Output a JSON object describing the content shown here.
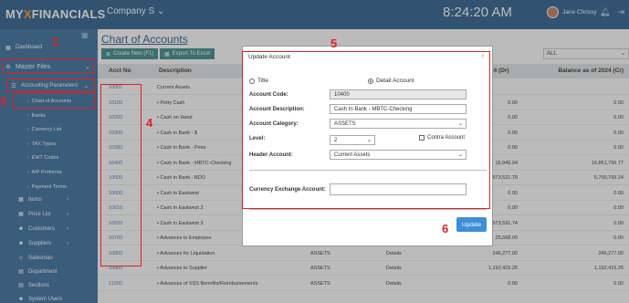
{
  "topbar": {
    "logo_prefix": "MY",
    "logo_x": "X",
    "logo_suffix": "FINANCIALS",
    "company": "Company S",
    "clock": "8:24:20 AM",
    "user_name": "Jane Chrissy"
  },
  "sidebar": {
    "items": [
      {
        "label": "Dashboard",
        "icon": "dashboard-icon"
      },
      {
        "label": "Master Files",
        "icon": "gear-icon"
      },
      {
        "label": "Accounting Parameters",
        "icon": "list-icon"
      },
      {
        "label": "Chart of Accounts"
      },
      {
        "label": "Banks"
      },
      {
        "label": "Currency List"
      },
      {
        "label": "TAX Types"
      },
      {
        "label": "EWT Codes"
      },
      {
        "label": "A/P Proforma"
      },
      {
        "label": "Payment Terms"
      },
      {
        "label": "Items",
        "icon": "grid-icon"
      },
      {
        "label": "Price List",
        "icon": "grid-icon"
      },
      {
        "label": "Customers",
        "icon": "users-icon"
      },
      {
        "label": "Suppliers",
        "icon": "users-icon"
      },
      {
        "label": "Salesman",
        "icon": "person-icon"
      },
      {
        "label": "Department",
        "icon": "building-icon"
      },
      {
        "label": "Sections",
        "icon": "building-icon"
      },
      {
        "label": "System Users",
        "icon": "users-icon"
      }
    ]
  },
  "main": {
    "page_title": "Chart of Accounts",
    "create_btn": "Create New (F1)",
    "export_btn": "Export To Excel",
    "filter_value": "ALL",
    "columns": [
      "Acct No",
      "Description",
      "(Dr)",
      "Balance as of 2024 (Cr)"
    ],
    "col_year_label": "24 (Dr)",
    "rows": [
      {
        "no": "10001",
        "desc": "Current Assets",
        "cat": "",
        "det": "",
        "bal1": "",
        "bal2": ""
      },
      {
        "no": "10100",
        "desc": "• Petty Cash",
        "cat": "",
        "det": "",
        "bal1": "0.00",
        "bal2": "0.00"
      },
      {
        "no": "10200",
        "desc": "• Cash on Hand",
        "cat": "",
        "det": "",
        "bal1": "0.00",
        "bal2": "0.00"
      },
      {
        "no": "10300",
        "desc": "• Cash in Bank - $",
        "cat": "",
        "det": "",
        "bal1": "0.00",
        "bal2": "0.00"
      },
      {
        "no": "10390",
        "desc": "• Cash in Bank - Peso",
        "cat": "",
        "det": "",
        "bal1": "0.00",
        "bal2": "0.00"
      },
      {
        "no": "10400",
        "desc": "• Cash in Bank - MBTC-Checking",
        "cat": "",
        "det": "",
        "bal1": "16,949.94",
        "bal2": "16,851,756.77"
      },
      {
        "no": "10500",
        "desc": "• Cash in Bank - BDO",
        "cat": "",
        "det": "",
        "bal1": "673,521.79",
        "bal2": "5,700,769.24"
      },
      {
        "no": "10600",
        "desc": "• Cash in Eastwest",
        "cat": "",
        "det": "",
        "bal1": "0.00",
        "bal2": "0.00"
      },
      {
        "no": "10610",
        "desc": "• Cash in Eastwest 2",
        "cat": "",
        "det": "",
        "bal1": "0.00",
        "bal2": "0.00"
      },
      {
        "no": "10620",
        "desc": "• Cash in Eastwest 3",
        "cat": "",
        "det": "",
        "bal1": "573,591.74",
        "bal2": "0.00"
      },
      {
        "no": "10700",
        "desc": "• Advances to Employee",
        "cat": "ASSETS",
        "det": "Details",
        "bal1": "25,668.00",
        "bal2": "0.00"
      },
      {
        "no": "10800",
        "desc": "• Advances for Liquidation",
        "cat": "ASSETS",
        "det": "Details",
        "bal1": "246,277.00",
        "bal2": "246,277.00"
      },
      {
        "no": "10900",
        "desc": "• Advances to Supplier",
        "cat": "ASSETS",
        "det": "Details",
        "bal1": "1,192,415.25",
        "bal2": "1,192,415.25"
      },
      {
        "no": "11000",
        "desc": "• Advances of SSS Benefits/Reimbursements",
        "cat": "ASSETS",
        "det": "Details",
        "bal1": "0.00",
        "bal2": "0.00"
      }
    ]
  },
  "modal": {
    "title": "Update Account",
    "radio_title": "Title",
    "radio_detail": "Detail Account",
    "code_label": "Account Code:",
    "code_value": "10400",
    "desc_label": "Account Description:",
    "desc_value": "Cash In Bank - MBTC-Checking",
    "category_label": "Account Category:",
    "category_value": "ASSETS",
    "level_label": "Level:",
    "level_value": "2",
    "contra_label": "Contra Account",
    "header_label": "Header Account:",
    "header_value": "Current Assets",
    "currency_label": "Currency Exchange Account:",
    "currency_value": "",
    "update_btn": "Update"
  },
  "annotations": [
    "1",
    "2",
    "3",
    "4",
    "5",
    "6"
  ],
  "colors": {
    "topbar": "#2c5f8d",
    "sidebar": "#3a6f9e",
    "accent": "#3d8ed8",
    "annotation": "#e02020"
  }
}
